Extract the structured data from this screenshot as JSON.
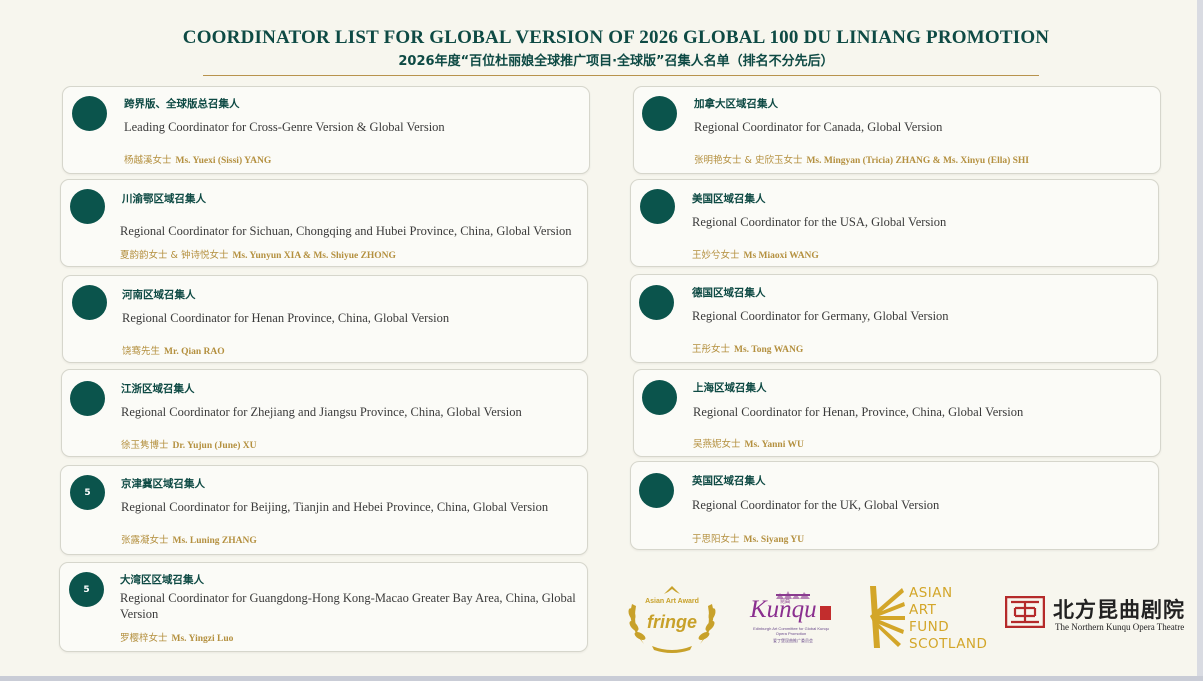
{
  "header": {
    "title_en": "COORDINATOR LIST FOR GLOBAL VERSION OF 2026 GLOBAL 100 DU LINIANG PROMOTION",
    "title_cn": "2026年度“百位杜丽娘全球推广项目·全球版”召集人名单（排名不分先后）"
  },
  "left_cards": [
    {
      "badge": "",
      "cn": "跨界版、全球版总召集人",
      "en": "Leading Coordinator for Cross-Genre Version & Global Version",
      "name_cn": "杨越溪女士",
      "name_en": "Ms. Yuexi (Sissi) YANG"
    },
    {
      "badge": "",
      "cn": "川渝鄂区域召集人",
      "en": "Regional Coordinator for Sichuan, Chongqing and Hubei Province, China, Global Version",
      "name_cn": "夏韵韵女士 & 钟诗悦女士",
      "name_en": "Ms. Yunyun XIA & Ms. Shiyue ZHONG"
    },
    {
      "badge": "",
      "cn": "河南区域召集人",
      "en": "Regional Coordinator for Henan Province, China, Global Version",
      "name_cn": "饶骞先生",
      "name_en": "Mr. Qian RAO"
    },
    {
      "badge": "",
      "cn": "江浙区域召集人",
      "en": "Regional Coordinator for Zhejiang and Jiangsu Province, China, Global Version",
      "name_cn": "徐玉隽博士",
      "name_en": "Dr. Yujun (June) XU"
    },
    {
      "badge": "5",
      "cn": "京津冀区域召集人",
      "en": "Regional Coordinator for Beijing, Tianjin and Hebei Province, China, Global Version",
      "name_cn": "张露凝女士",
      "name_en": "Ms. Luning ZHANG"
    },
    {
      "badge": "5",
      "cn": "大湾区区域召集人",
      "en": "Regional Coordinator for Guangdong-Hong Kong-Macao Greater Bay Area, China, Global Version",
      "name_cn": "罗樱梓女士",
      "name_en": "Ms. Yingzi Luo"
    }
  ],
  "right_cards": [
    {
      "badge": "",
      "cn": "加拿大区域召集人",
      "en": "Regional Coordinator for Canada, Global Version",
      "name_cn": "张明艳女士 & 史欣玉女士",
      "name_en": "Ms. Mingyan (Tricia) ZHANG & Ms. Xinyu (Ella) SHI"
    },
    {
      "badge": "",
      "cn": "美国区域召集人",
      "en": "Regional Coordinator for the USA, Global Version",
      "name_cn": "王妙兮女士",
      "name_en": "Ms Miaoxi WANG"
    },
    {
      "badge": "",
      "cn": "德国区域召集人",
      "en": "Regional Coordinator for Germany, Global Version",
      "name_cn": "王彤女士",
      "name_en": "Ms. Tong WANG"
    },
    {
      "badge": "",
      "cn": "上海区域召集人",
      "en": "Regional Coordinator for Henan, Province, China, Global Version",
      "name_cn": "吴燕妮女士",
      "name_en": "Ms. Yanni WU"
    },
    {
      "badge": "",
      "cn": "英国区域召集人",
      "en": "Regional Coordinator for the UK, Global Version",
      "name_cn": "于思阳女士",
      "name_en": "Ms. Siyang YU"
    }
  ],
  "logos": {
    "fringe": {
      "top": "Asian Art Award",
      "main": "fringe"
    },
    "kunqu": {
      "main": "Kunqu",
      "top_cn": "昆曲",
      "sub": "Edinburgh Art Committee for Global Kunqu Opera Promotion",
      "sub_cn": "爱丁堡昆曲推广委员会"
    },
    "aaf": {
      "line1": "ASIAN",
      "line2": "ART",
      "line3": "FUND",
      "line4": "SCOTLAND"
    },
    "nkot": {
      "cn": "北方昆曲剧院",
      "en": "The Northern Kunqu Opera Theatre"
    }
  },
  "colors": {
    "accent": "#0b544c",
    "gold": "#b4903f",
    "background": "#f7f6ee"
  }
}
